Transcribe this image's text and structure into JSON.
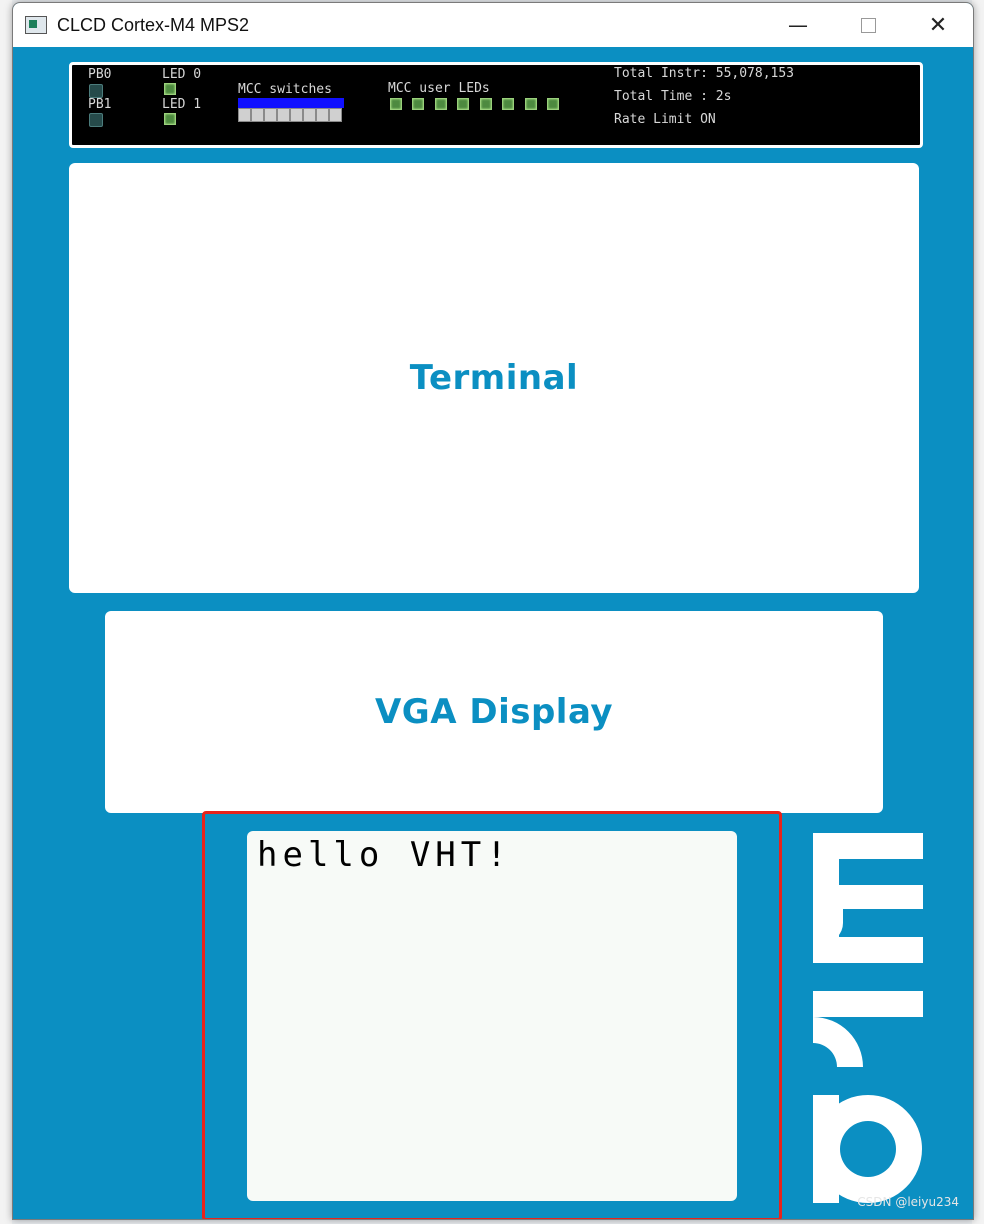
{
  "window": {
    "title": "CLCD Cortex-M4 MPS2",
    "controls": {
      "minimize": "—",
      "close": "✕"
    }
  },
  "status": {
    "pb0": "PB0",
    "pb1": "PB1",
    "led0": "LED 0",
    "led1": "LED 1",
    "mcc_switches": "MCC switches",
    "mcc_user_leds": "MCC user LEDs",
    "total_instr": "Total Instr: 55,078,153",
    "total_time": "Total Time : 2s",
    "rate_limit": "Rate Limit ON"
  },
  "panels": {
    "terminal": "Terminal",
    "vga": "VGA Display"
  },
  "lcd": {
    "text": "hello VHT!"
  },
  "logo": {
    "text": "arm"
  },
  "watermark": "CSDN @leiyu234",
  "colors": {
    "board": "#0b8fc2",
    "highlight": "#e8231b",
    "led_green": "#4d8a3f",
    "switch_blue": "#1010ff"
  },
  "icons": {
    "app": "window-app-icon",
    "minimize": "minimize-icon",
    "maximize": "maximize-icon",
    "close": "close-icon"
  }
}
